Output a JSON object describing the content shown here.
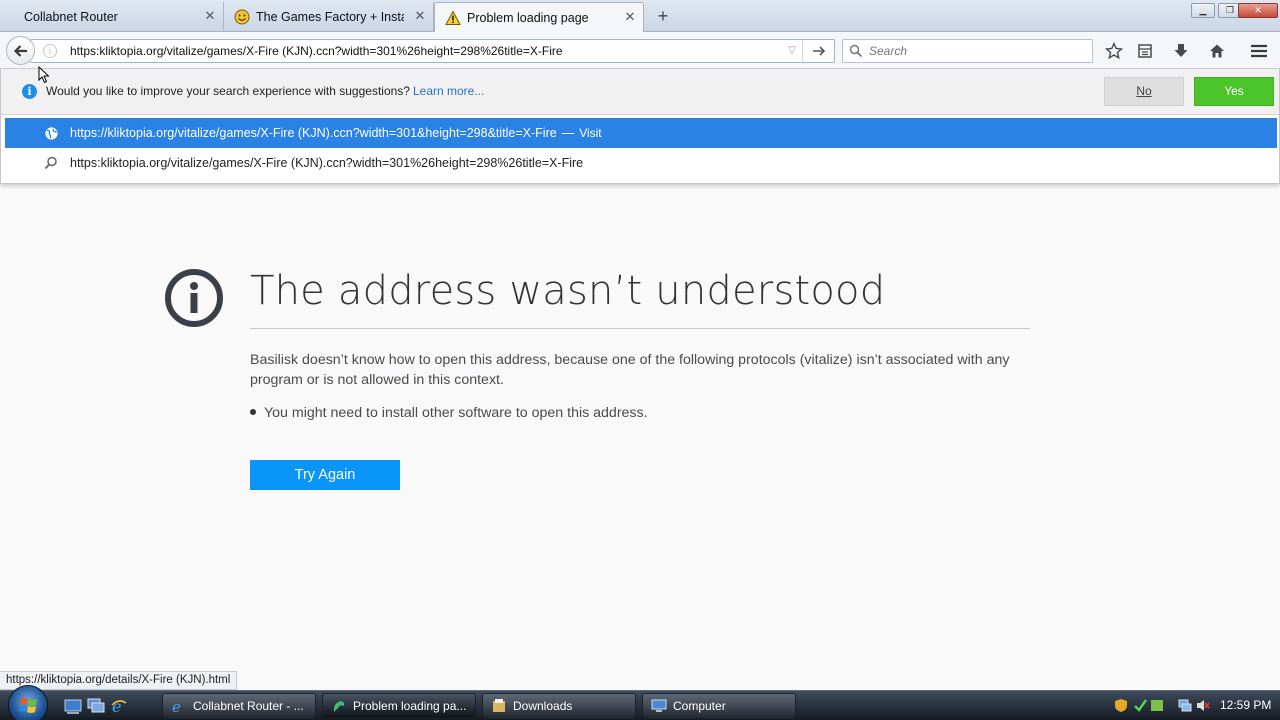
{
  "tabs": [
    {
      "label": "Collabnet Router",
      "active": false
    },
    {
      "label": "The Games Factory + Install",
      "active": false
    },
    {
      "label": "Problem loading page",
      "active": true
    }
  ],
  "newtab_icon": "plus-icon",
  "window_controls": {
    "min": "minimize-icon",
    "max": "maximize-icon",
    "close": "close-icon"
  },
  "navbar": {
    "url": "https:kliktopia.org/vitalize/games/X-Fire (KJN).ccn?width=301%26height=298%26title=X-Fire",
    "search_placeholder": "Search"
  },
  "suggest_bar": {
    "message": "Would you like to improve your search experience with suggestions?",
    "learn_more": "Learn more...",
    "no_label": "No",
    "yes_label": "Yes"
  },
  "autocomplete": [
    {
      "text": "https://kliktopia.org/vitalize/games/X-Fire (KJN).ccn?width=301&height=298&title=X-Fire",
      "sep": "—",
      "action": "Visit",
      "icon": "globe-icon",
      "selected": true
    },
    {
      "text": "https:kliktopia.org/vitalize/games/X-Fire (KJN).ccn?width=301%26height=298%26title=X-Fire",
      "icon": "search-icon",
      "selected": false
    }
  ],
  "error": {
    "title": "The address wasn’t understood",
    "description": "Basilisk doesn’t know how to open this address, because one of the following protocols (vitalize) isn’t associated with any program or is not allowed in this context.",
    "bullet": "You might need to install other software to open this address.",
    "button": "Try Again"
  },
  "status_link": "https://kliktopia.org/details/X-Fire (KJN).html",
  "taskbar": {
    "items": [
      {
        "label": "Collabnet Router - ...",
        "icon": "ie-icon"
      },
      {
        "label": "Problem loading pa...",
        "icon": "browser-icon"
      },
      {
        "label": "Downloads",
        "icon": "folder-icon"
      },
      {
        "label": "Computer",
        "icon": "computer-icon"
      }
    ],
    "clock": "12:59 PM"
  },
  "colors": {
    "accent": "#0996f8",
    "selection": "#2a82e4",
    "yes": "#4cc52a"
  }
}
